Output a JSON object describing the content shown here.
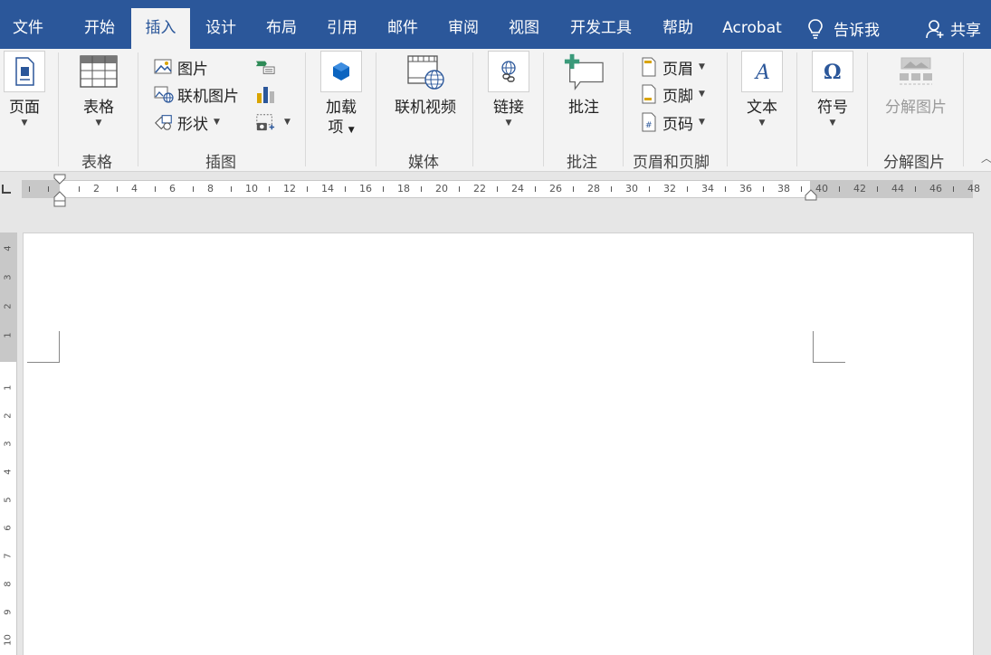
{
  "tabs": [
    {
      "label": "文件"
    },
    {
      "label": "开始"
    },
    {
      "label": "插入"
    },
    {
      "label": "设计"
    },
    {
      "label": "布局"
    },
    {
      "label": "引用"
    },
    {
      "label": "邮件"
    },
    {
      "label": "审阅"
    },
    {
      "label": "视图"
    },
    {
      "label": "开发工具"
    },
    {
      "label": "帮助"
    },
    {
      "label": "Acrobat"
    }
  ],
  "tell_me": "告诉我",
  "share": "共享",
  "ribbon": {
    "pages": {
      "button": "页面",
      "icon": "page-icon"
    },
    "tables": {
      "button": "表格",
      "group": "表格",
      "icon": "table-icon"
    },
    "illustrations": {
      "group": "插图",
      "pictures": "图片",
      "online_pictures": "联机图片",
      "shapes": "形状"
    },
    "addins": {
      "button_line1": "加载",
      "button_line2": "项",
      "icon": "store-icon"
    },
    "media": {
      "button": "联机视频",
      "group": "媒体",
      "icon": "online-video-icon"
    },
    "links": {
      "button": "链接",
      "icon": "link-icon"
    },
    "comments": {
      "button": "批注",
      "group": "批注",
      "icon": "comment-icon"
    },
    "header_footer": {
      "group": "页眉和页脚",
      "header": "页眉",
      "footer": "页脚",
      "page_number": "页码"
    },
    "text": {
      "button": "文本",
      "icon": "text-box-icon"
    },
    "symbols": {
      "button": "符号",
      "icon": "omega-icon"
    },
    "split_picture": {
      "button": "分解图片",
      "group": "分解图片",
      "icon": "split-picture-icon"
    }
  },
  "hruler_numbers": [
    "2",
    "4",
    "6",
    "8",
    "10",
    "12",
    "14",
    "16",
    "18",
    "20",
    "22",
    "24",
    "26",
    "28",
    "30",
    "32",
    "34",
    "36",
    "38",
    "40",
    "42",
    "44",
    "46",
    "48"
  ],
  "vruler_top_numbers": [
    "4",
    "3",
    "2",
    "1"
  ],
  "vruler_numbers": [
    "1",
    "2",
    "3",
    "4",
    "5",
    "6",
    "7",
    "8",
    "9",
    "10"
  ],
  "colors": {
    "accent": "#2b579a",
    "ribbon_bg": "#f3f3f3",
    "workspace_bg": "#e6e6e6"
  }
}
